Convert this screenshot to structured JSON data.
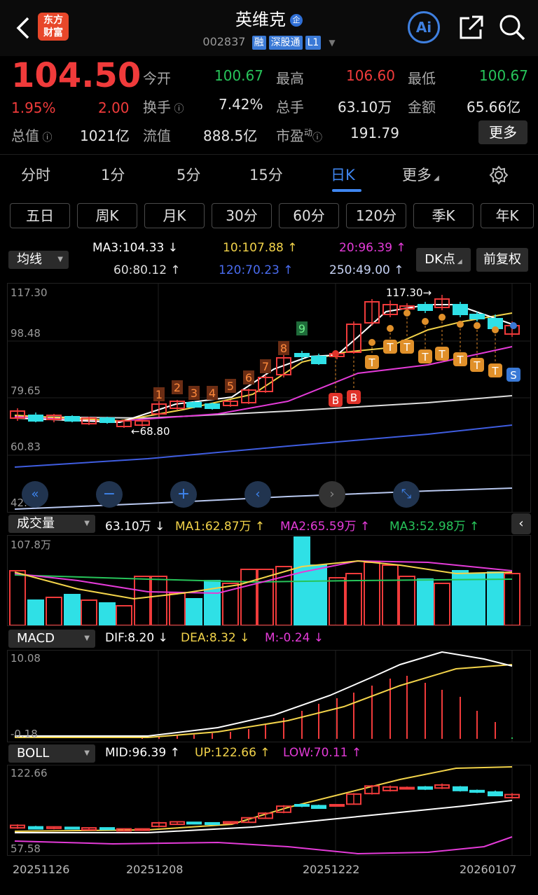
{
  "header": {
    "logo_line1": "东方",
    "logo_line2": "财富",
    "stock_name": "英维克",
    "name_badge": "企",
    "stock_code": "002837",
    "tags": [
      "融",
      "深股通",
      "L1"
    ],
    "ai_label": "Ai"
  },
  "quote": {
    "price": "104.50",
    "change_pct": "1.95%",
    "change_amt": "2.00",
    "open_label": "今开",
    "open": "100.67",
    "high_label": "最高",
    "high": "106.60",
    "low_label": "最低",
    "low": "100.67",
    "turnover_label": "换手",
    "turnover": "7.42%",
    "volume_label": "总手",
    "volume": "63.10万",
    "amount_label": "金额",
    "amount": "65.66亿",
    "mktcap_label": "总值",
    "mktcap": "1021亿",
    "float_label": "流值",
    "float_cap": "888.5亿",
    "pe_label": "市盈",
    "pe_sup": "动",
    "pe": "191.79",
    "more_button": "更多"
  },
  "tabs": [
    "分时",
    "1分",
    "5分",
    "15分",
    "日K",
    "更多"
  ],
  "active_tab": "日K",
  "periods": [
    "五日",
    "周K",
    "月K",
    "30分",
    "60分",
    "120分",
    "季K",
    "年K"
  ],
  "ma_bar": {
    "selector": "均线",
    "ma3": "MA3:104.33",
    "ma10": "10:107.88",
    "ma20": "20:96.39",
    "ma60": "60:80.12",
    "ma120": "120:70.23",
    "ma250": "250:49.00",
    "dk_button": "DK点",
    "adjust_button": "前复权"
  },
  "kline": {
    "y_ticks": [
      "117.30",
      "98.48",
      "79.65",
      "60.83",
      "42.01"
    ],
    "high_marker": "117.30",
    "low_marker": "68.80",
    "td_numbers": [
      "1",
      "2",
      "3",
      "4",
      "5",
      "6",
      "7",
      "8",
      "9"
    ],
    "signals": [
      "B",
      "B",
      "S"
    ],
    "t_label": "T"
  },
  "volume_panel": {
    "selector": "成交量",
    "value": "63.10万",
    "ma1": "MA1:62.87万",
    "ma2": "MA2:65.59万",
    "ma3": "MA3:52.98万",
    "y_top": "107.8万"
  },
  "macd_panel": {
    "selector": "MACD",
    "dif": "DIF:8.20",
    "dea": "DEA:8.32",
    "m": "M:-0.24",
    "y_top": "10.08",
    "y_bottom": "-0.18"
  },
  "boll_panel": {
    "selector": "BOLL",
    "mid": "MID:96.39",
    "up": "UP:122.66",
    "low": "LOW:70.11",
    "y_top": "122.66",
    "y_bottom": "57.58"
  },
  "x_dates": [
    "20251126",
    "20251208",
    "20251222",
    "20260107"
  ],
  "colors": {
    "up": "#f03b3b",
    "down": "#2fe0e6",
    "ma3": "#ffffff",
    "ma10": "#f2d34a",
    "ma20": "#e43bd8",
    "ma60": "#dddddd",
    "ma120": "#3f5de0",
    "ma250": "#b9c9f0",
    "accent": "#3f86f0"
  }
}
